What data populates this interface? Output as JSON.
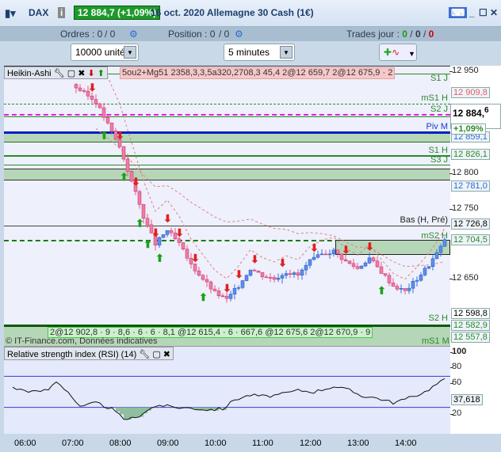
{
  "title": {
    "symbol": "DAX",
    "price": "12 884,7 (+1,09%)",
    "desc": "16 oct. 2020 Allemagne 30 Cash (1€)"
  },
  "bar2": {
    "ordres": "Ordres : 0",
    "ordres2": "/ 0",
    "position": "Position : 0",
    "position2": "/ 0",
    "trades_label": "Trades jour : ",
    "t1": "0",
    "t2": "0",
    "t3": "0",
    "colors": {
      "t1": "#1a9a1a",
      "t3": "#cc0000"
    }
  },
  "toolbar": {
    "units": "10000 unités",
    "interval": "5 minutes"
  },
  "indicator_header": "Heikin-Ashi",
  "order_tags_top": "5ou2+Mg51 2358,3,3,5a320,2708,3  45,4  2@12 659,7   2@12 675,9 · 2",
  "order_tags_bottom": "2@12 902,8 · 9 · 8,6 · 6 · 6 · 8,1 @12 615,4 · 6 · 667,6 @12 675,6  2@12 670,9 · 9",
  "copyright": "© IT-Finance.com, Données indicatives",
  "levels": {
    "s1j": "S1 J",
    "ms1h": "mS1 H",
    "s2j": "S2 J",
    "pivm": "Piv M",
    "s1h": "S1 H",
    "s3j": "S3 J",
    "bas": "Bas (H, Pré)",
    "ms2h": "mS2 H",
    "s2h": "S2 H",
    "ms1m": "mS1 M"
  },
  "axis": {
    "ticks": [
      "12 950",
      "12 800",
      "12 750",
      "12 650"
    ],
    "labels": [
      "12 909,8",
      "12 859,1",
      "12 826,1",
      "12 781,0",
      "12 726,8",
      "12 704,5",
      "12 598,8",
      "12 582,9",
      "12 557,8"
    ],
    "last_main": "12 884,",
    "last_frac": "6",
    "change": "+1,09%"
  },
  "rsi": {
    "header": "Relative strength index (RSI) (14)",
    "ticks": [
      "100",
      "80",
      "60",
      "20"
    ],
    "value": "37,618"
  },
  "time_labels": [
    "06:00",
    "07:00",
    "08:00",
    "09:00",
    "10:00",
    "11:00",
    "12:00",
    "13:00",
    "14:00"
  ],
  "chart_data": {
    "type": "candlestick",
    "style": "Heikin-Ashi",
    "interval_min": 5,
    "price_path": [
      [
        "07:00",
        12930
      ],
      [
        "07:30",
        12905
      ],
      [
        "08:00",
        12840
      ],
      [
        "08:15",
        12790
      ],
      [
        "08:30",
        12740
      ],
      [
        "08:45",
        12700
      ],
      [
        "09:00",
        12720
      ],
      [
        "09:15",
        12700
      ],
      [
        "09:30",
        12670
      ],
      [
        "09:45",
        12650
      ],
      [
        "10:00",
        12630
      ],
      [
        "10:15",
        12620
      ],
      [
        "10:30",
        12640
      ],
      [
        "10:45",
        12665
      ],
      [
        "11:00",
        12655
      ],
      [
        "11:15",
        12650
      ],
      [
        "11:30",
        12660
      ],
      [
        "11:45",
        12655
      ],
      [
        "12:00",
        12675
      ],
      [
        "12:15",
        12685
      ],
      [
        "12:30",
        12690
      ],
      [
        "12:45",
        12675
      ],
      [
        "13:00",
        12665
      ],
      [
        "13:15",
        12680
      ],
      [
        "13:30",
        12660
      ],
      [
        "13:45",
        12640
      ],
      [
        "14:00",
        12632
      ],
      [
        "14:15",
        12650
      ],
      [
        "14:30",
        12670
      ],
      [
        "14:45",
        12695
      ],
      [
        "14:52",
        12712
      ]
    ],
    "rsi_path": [
      [
        "05:45",
        55
      ],
      [
        "06:00",
        52
      ],
      [
        "06:15",
        50
      ],
      [
        "06:30",
        53
      ],
      [
        "06:40",
        64
      ],
      [
        "06:55",
        50
      ],
      [
        "07:10",
        30
      ],
      [
        "07:30",
        36
      ],
      [
        "07:50",
        28
      ],
      [
        "08:05",
        15
      ],
      [
        "08:20",
        16
      ],
      [
        "08:35",
        27
      ],
      [
        "08:50",
        33
      ],
      [
        "09:10",
        30
      ],
      [
        "09:30",
        29
      ],
      [
        "09:50",
        27
      ],
      [
        "10:10",
        28
      ],
      [
        "10:25",
        40
      ],
      [
        "10:45",
        46
      ],
      [
        "11:05",
        44
      ],
      [
        "11:25",
        47
      ],
      [
        "11:45",
        52
      ],
      [
        "12:05",
        50
      ],
      [
        "12:30",
        57
      ],
      [
        "12:50",
        52
      ],
      [
        "13:05",
        45
      ],
      [
        "13:25",
        42
      ],
      [
        "13:45",
        36
      ],
      [
        "14:05",
        42
      ],
      [
        "14:25",
        50
      ],
      [
        "14:40",
        60
      ],
      [
        "14:52",
        67
      ]
    ],
    "signals": [
      [
        "07:25",
        "sell"
      ],
      [
        "07:40",
        "buy"
      ],
      [
        "08:00",
        "sell"
      ],
      [
        "08:05",
        "buy"
      ],
      [
        "08:20",
        "sell"
      ],
      [
        "08:25",
        "buy"
      ],
      [
        "08:35",
        "buy"
      ],
      [
        "08:45",
        "sell"
      ],
      [
        "08:50",
        "buy"
      ],
      [
        "09:00",
        "sell"
      ],
      [
        "09:15",
        "sell"
      ],
      [
        "09:35",
        "sell"
      ],
      [
        "09:45",
        "buy"
      ],
      [
        "10:15",
        "sell"
      ],
      [
        "10:30",
        "sell"
      ],
      [
        "10:50",
        "sell"
      ],
      [
        "11:25",
        "sell"
      ],
      [
        "12:05",
        "sell"
      ],
      [
        "12:45",
        "sell"
      ],
      [
        "13:15",
        "sell"
      ],
      [
        "13:30",
        "buy"
      ]
    ]
  }
}
